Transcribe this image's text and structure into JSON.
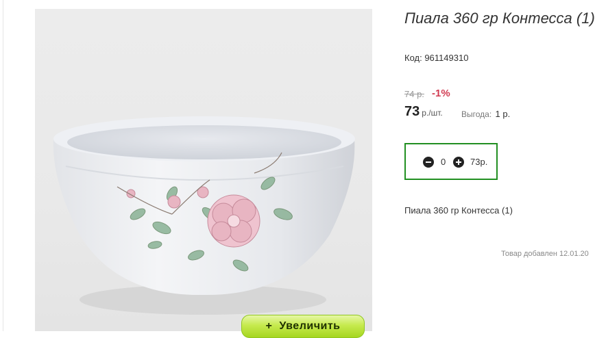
{
  "product": {
    "title": "Пиала 360 гр Контесса (1)",
    "code": "Код: 961149310",
    "old_price": "74 р.",
    "discount": "-1%",
    "price": "73",
    "price_unit": "р./шт.",
    "saving_label": "Выгода:",
    "saving_value": "1 р.",
    "description": "Пиала 360 гр Контесса (1)",
    "added": "Товар добавлен 12.01.20"
  },
  "cart": {
    "quantity": "0",
    "sum": "73р."
  },
  "image": {
    "zoom_label": "Увеличить",
    "zoom_icon": "+"
  }
}
